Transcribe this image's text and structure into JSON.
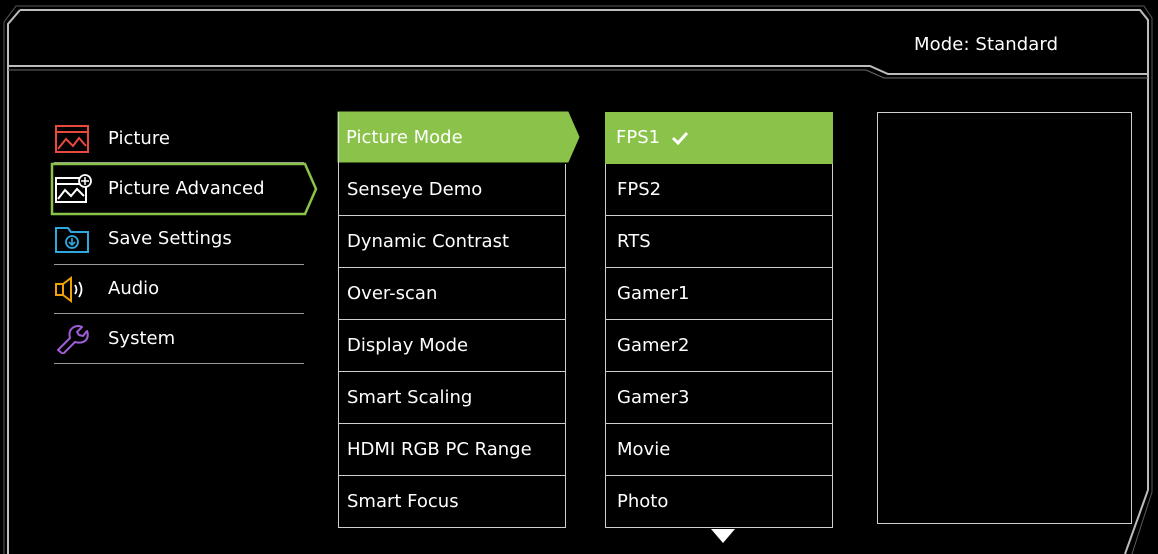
{
  "header": {
    "mode_label": "Mode: Standard"
  },
  "categories": [
    {
      "label": "Picture",
      "icon": "picture-icon"
    },
    {
      "label": "Picture Advanced",
      "icon": "picture-advanced-icon",
      "selected": true
    },
    {
      "label": "Save Settings",
      "icon": "save-settings-icon"
    },
    {
      "label": "Audio",
      "icon": "audio-icon"
    },
    {
      "label": "System",
      "icon": "system-wrench-icon"
    }
  ],
  "submenu": [
    {
      "label": "Picture Mode",
      "selected": true
    },
    {
      "label": "Senseye Demo"
    },
    {
      "label": "Dynamic Contrast"
    },
    {
      "label": "Over-scan"
    },
    {
      "label": "Display Mode"
    },
    {
      "label": "Smart Scaling"
    },
    {
      "label": "HDMI RGB PC Range"
    },
    {
      "label": "Smart Focus"
    }
  ],
  "options": [
    {
      "label": "FPS1",
      "selected": true,
      "checked": true
    },
    {
      "label": "FPS2"
    },
    {
      "label": "RTS"
    },
    {
      "label": "Gamer1"
    },
    {
      "label": "Gamer2"
    },
    {
      "label": "Gamer3"
    },
    {
      "label": "Movie"
    },
    {
      "label": "Photo"
    }
  ],
  "colors": {
    "accent_green": "#8bc34a",
    "icon_red": "#e8493f",
    "icon_blue": "#2fa8e0",
    "icon_orange": "#f2a007",
    "icon_purple": "#a05ed8"
  },
  "scroll_indicator": "down-triangle-icon"
}
